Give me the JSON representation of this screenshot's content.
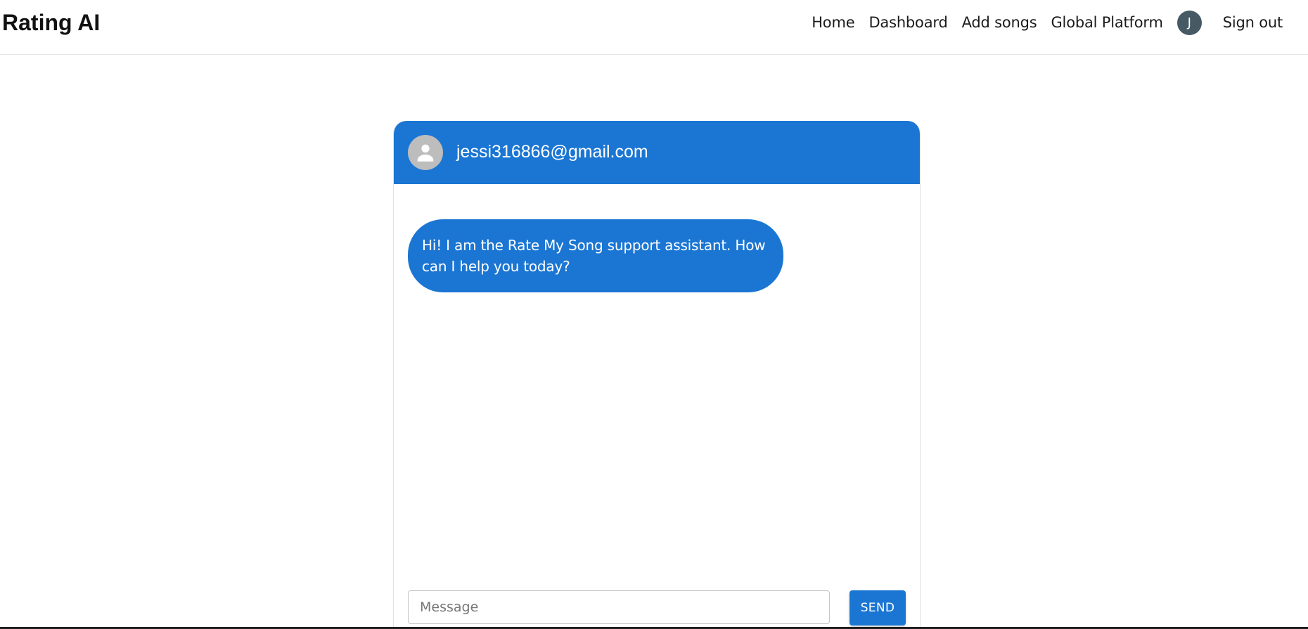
{
  "app": {
    "brand": "Rating AI"
  },
  "nav": {
    "items": [
      {
        "label": "Home"
      },
      {
        "label": "Dashboard"
      },
      {
        "label": "Add songs"
      },
      {
        "label": "Global Platform"
      }
    ],
    "avatar_initial": "J",
    "sign_out": "Sign out"
  },
  "chat": {
    "header_email": "jessi316866@gmail.com",
    "header_avatar_icon": "person-icon",
    "messages": [
      {
        "from": "assistant",
        "text": "Hi! I am the Rate My Song support assistant. How can I help you today?"
      }
    ],
    "input": {
      "value": "",
      "placeholder": "Message"
    },
    "send_label": "SEND"
  },
  "colors": {
    "accent": "#1b76d3",
    "avatar_bg": "#455a64",
    "header_avatar_bg": "#bdbdbd"
  }
}
